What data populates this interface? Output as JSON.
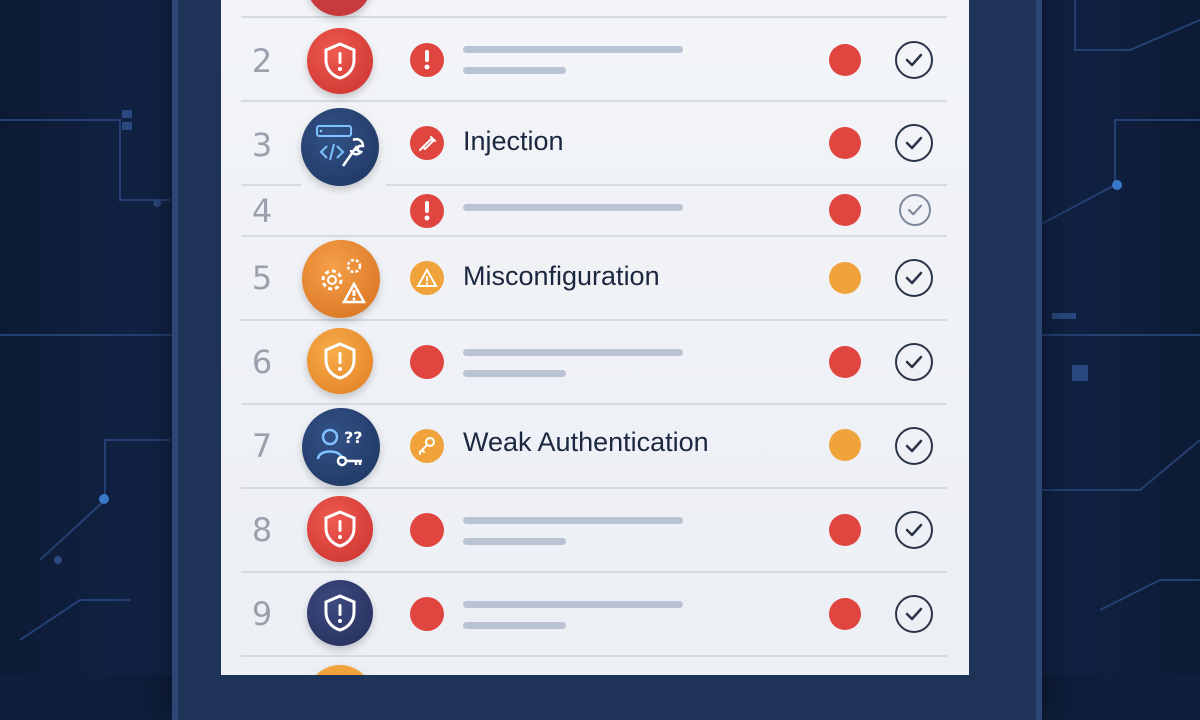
{
  "colors": {
    "critical": "#e0453f",
    "warning": "#f0a33a",
    "navy": "#243c66",
    "indigo": "#2c3868",
    "orange_badge": "#ec8a2f"
  },
  "rows": [
    {
      "number": "",
      "badge_icon": "shield-alert-icon",
      "status_icon": "",
      "title": "",
      "severity": "critical"
    },
    {
      "number": "2",
      "badge_icon": "shield-alert-icon",
      "status_icon": "alert-icon",
      "title": "",
      "severity": "critical"
    },
    {
      "number": "3",
      "badge_icon": "code-wrench-icon",
      "status_icon": "syringe-icon",
      "title": "Injection",
      "severity": "critical"
    },
    {
      "number": "4",
      "badge_icon": "",
      "status_icon": "alert-icon",
      "title": "",
      "severity": "critical"
    },
    {
      "number": "5",
      "badge_icon": "gears-warning-icon",
      "status_icon": "warning-triangle-icon",
      "title": "Misconfiguration",
      "severity": "warning"
    },
    {
      "number": "6",
      "badge_icon": "shield-alert-icon",
      "status_icon": "red-dot-icon",
      "title": "",
      "severity": "critical"
    },
    {
      "number": "7",
      "badge_icon": "user-key-icon",
      "status_icon": "key-icon",
      "title": "Weak Authentication",
      "severity": "warning"
    },
    {
      "number": "8",
      "badge_icon": "shield-alert-icon",
      "status_icon": "red-dot-icon",
      "title": "",
      "severity": "critical"
    },
    {
      "number": "9",
      "badge_icon": "shield-alert-icon",
      "status_icon": "red-dot-icon",
      "title": "",
      "severity": "critical"
    }
  ]
}
